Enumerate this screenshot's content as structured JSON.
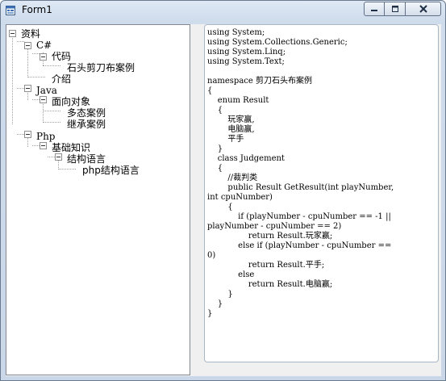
{
  "window": {
    "title": "Form1"
  },
  "titlebar_icons": {
    "app": "form-icon",
    "minimize": "minimize-icon",
    "maximize": "maximize-icon",
    "close": "close-icon"
  },
  "tree": {
    "nodes": [
      {
        "label": "资料",
        "level": 0,
        "expanded": true
      },
      {
        "label": "C#",
        "level": 1,
        "expanded": true
      },
      {
        "label": "代码",
        "level": 2,
        "expanded": true
      },
      {
        "label": "石头剪刀布案例",
        "level": 3
      },
      {
        "label": "介绍",
        "level": 2
      },
      {
        "label": "Java",
        "level": 1,
        "expanded": true
      },
      {
        "label": "面向对象",
        "level": 2,
        "expanded": true
      },
      {
        "label": "多态案例",
        "level": 3
      },
      {
        "label": "继承案例",
        "level": 3
      },
      {
        "label": "Php",
        "level": 1,
        "expanded": true
      },
      {
        "label": "基础知识",
        "level": 2,
        "expanded": true
      },
      {
        "label": "结构语言",
        "level": 3,
        "expanded": true
      },
      {
        "label": "php结构语言",
        "level": 4
      }
    ]
  },
  "code": {
    "lines": [
      "using System;",
      "using System.Collections.Generic;",
      "using System.Linq;",
      "using System.Text;",
      "",
      "namespace 剪刀石头布案例",
      "{",
      "    enum Result",
      "    {",
      "        玩家赢,",
      "        电脑赢,",
      "        平手",
      "    }",
      "    class Judgement",
      "    {",
      "        //裁判类",
      "        public Result GetResult(int playNumber,",
      "int cpuNumber)",
      "        {",
      "            if (playNumber - cpuNumber == -1 ||",
      "playNumber - cpuNumber == 2)",
      "                return Result.玩家赢;",
      "            else if (playNumber - cpuNumber ==",
      "0)",
      "                return Result.平手;",
      "            else",
      "                return Result.电脑赢;",
      "        }",
      "    }",
      "}"
    ]
  }
}
